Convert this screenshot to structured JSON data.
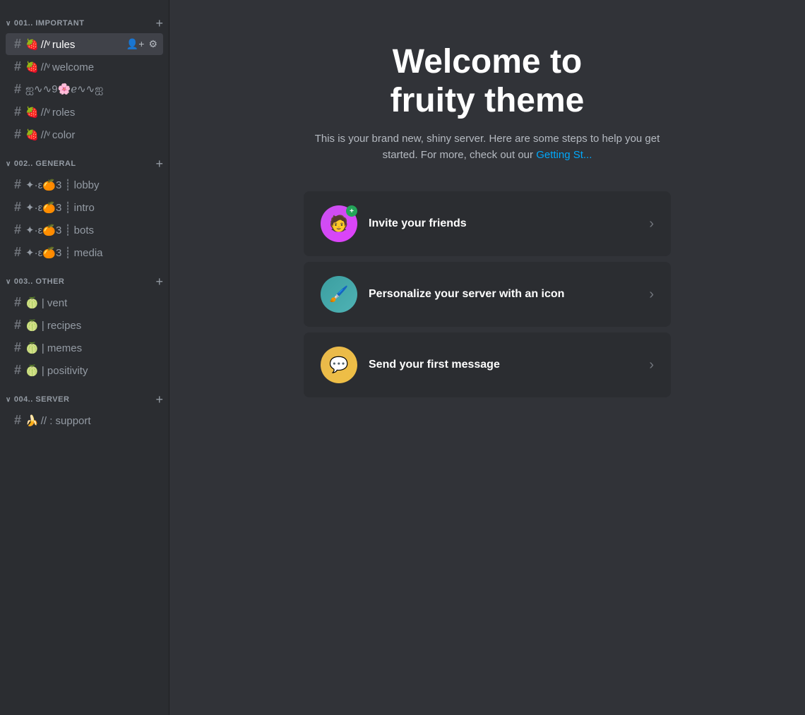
{
  "sidebar": {
    "categories": [
      {
        "id": "important",
        "label": "001.. IMPORTANT",
        "channels": [
          {
            "id": "rules",
            "name": "🍓 //ᵛ rules",
            "active": true
          },
          {
            "id": "welcome",
            "name": "🍓 //ᵛ welcome",
            "active": false
          },
          {
            "id": "decorative",
            "name": "ஐ∿∿9🌸ℯ∿∿ஐ",
            "active": false
          },
          {
            "id": "roles",
            "name": "🍓 //ᵛ roles",
            "active": false
          },
          {
            "id": "color",
            "name": "🍓 //ᵛ color",
            "active": false
          }
        ]
      },
      {
        "id": "general",
        "label": "002.. GENERAL",
        "channels": [
          {
            "id": "lobby",
            "name": "✦·ε🍊3 ┊ lobby",
            "active": false
          },
          {
            "id": "intro",
            "name": "✦·ε🍊3 ┊ intro",
            "active": false
          },
          {
            "id": "bots",
            "name": "✦·ε🍊3 ┊ bots",
            "active": false
          },
          {
            "id": "media",
            "name": "✦·ε🍊3 ┊ media",
            "active": false
          }
        ]
      },
      {
        "id": "other",
        "label": "003.. OTHER",
        "channels": [
          {
            "id": "vent",
            "name": "🍈 | vent",
            "active": false
          },
          {
            "id": "recipes",
            "name": "🍈 | recipes",
            "active": false
          },
          {
            "id": "memes",
            "name": "🍈 | memes",
            "active": false
          },
          {
            "id": "positivity",
            "name": "🍈 | positivity",
            "active": false
          }
        ]
      },
      {
        "id": "server",
        "label": "004.. SERVER",
        "channels": [
          {
            "id": "support",
            "name": "🍌 // : support",
            "active": false
          }
        ]
      }
    ]
  },
  "main": {
    "welcome_title": "Welcome to\nfruity theme",
    "welcome_subtitle": "This is your brand new, shiny server. Here are some steps to help you get started. For more, check out our",
    "getting_started_link": "Getting St...",
    "cards": [
      {
        "id": "invite",
        "icon": "👤",
        "icon_style": "purple",
        "label": "Invite your friends",
        "has_badge": true,
        "badge_text": "+"
      },
      {
        "id": "personalize",
        "icon": "🎨",
        "icon_style": "teal",
        "label": "Personalize your server with an icon",
        "has_badge": false
      },
      {
        "id": "first-message",
        "icon": "💬",
        "icon_style": "yellow",
        "label": "Send your first message",
        "has_badge": false
      }
    ]
  },
  "icons": {
    "add_member": "👤+",
    "settings": "⚙"
  }
}
